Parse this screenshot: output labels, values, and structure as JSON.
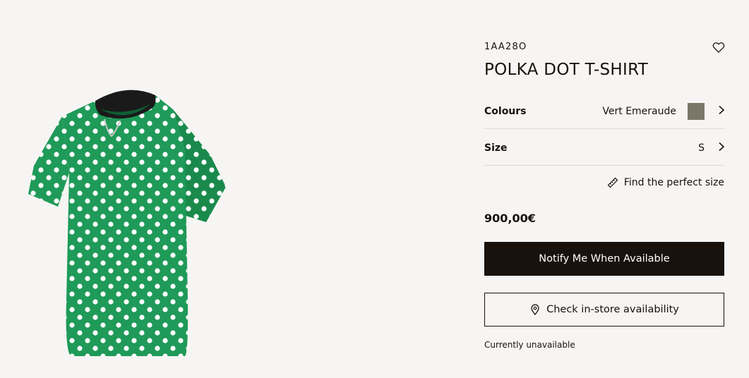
{
  "product": {
    "reference": "1AA28O",
    "title": "POLKA DOT T-SHIRT",
    "price": "900,00€",
    "image": {
      "description_icon": "tshirt-image",
      "main_color": "#1f9a58",
      "dot_color": "#ffffff",
      "collar_color": "#1a1a1a"
    }
  },
  "options": {
    "colours_label": "Colours",
    "colours_value": "Vert Emeraude",
    "swatch_color": "#7a7768",
    "size_label": "Size",
    "size_value": "S"
  },
  "find_size_label": "Find the perfect size",
  "buttons": {
    "notify": "Notify Me When Available",
    "store": "Check in-store availability"
  },
  "status": "Currently unavailable",
  "icons": {
    "wishlist": "heart-icon",
    "chevron": "chevron-right-icon",
    "ruler": "ruler-icon",
    "location": "location-pin-icon"
  }
}
